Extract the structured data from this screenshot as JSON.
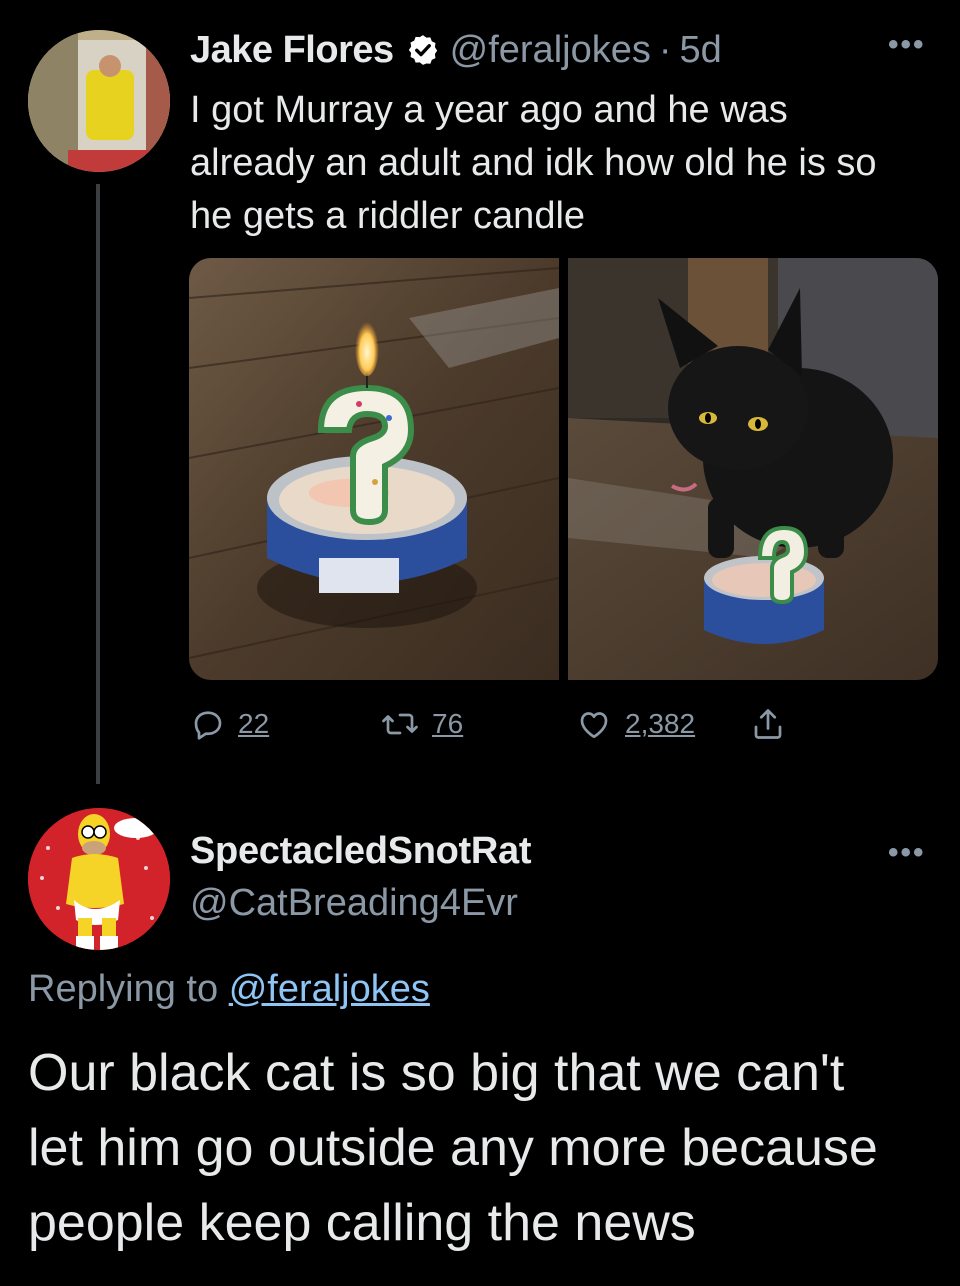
{
  "tweet1": {
    "author_name": "Jake Flores",
    "handle": "@feraljokes",
    "separator": "·",
    "time": "5d",
    "text_lines": [
      "I got Murray a year ago and he was",
      "already an adult and idk how old he is so",
      "he gets a riddler candle"
    ],
    "stats": {
      "replies": "22",
      "retweets": "76",
      "likes": "2,382"
    },
    "more_label": "•••"
  },
  "tweet2": {
    "author_name": "SpectacledSnotRat",
    "handle": "@CatBreading4Evr",
    "replying_prefix": "Replying to",
    "replying_mention": "@feraljokes",
    "text_lines": [
      "Our black cat is so big that we can't",
      "let him go outside any more because",
      "people keep calling the news"
    ],
    "more_label": "•••"
  },
  "colors": {
    "background": "#000000",
    "text": "#e7e9ea",
    "muted": "#8b98a5",
    "link": "#8ec5f5",
    "verified": "#ffffff"
  },
  "icons": [
    "verified-badge-icon",
    "more-icon",
    "reply-icon",
    "retweet-icon",
    "like-icon",
    "share-icon"
  ]
}
